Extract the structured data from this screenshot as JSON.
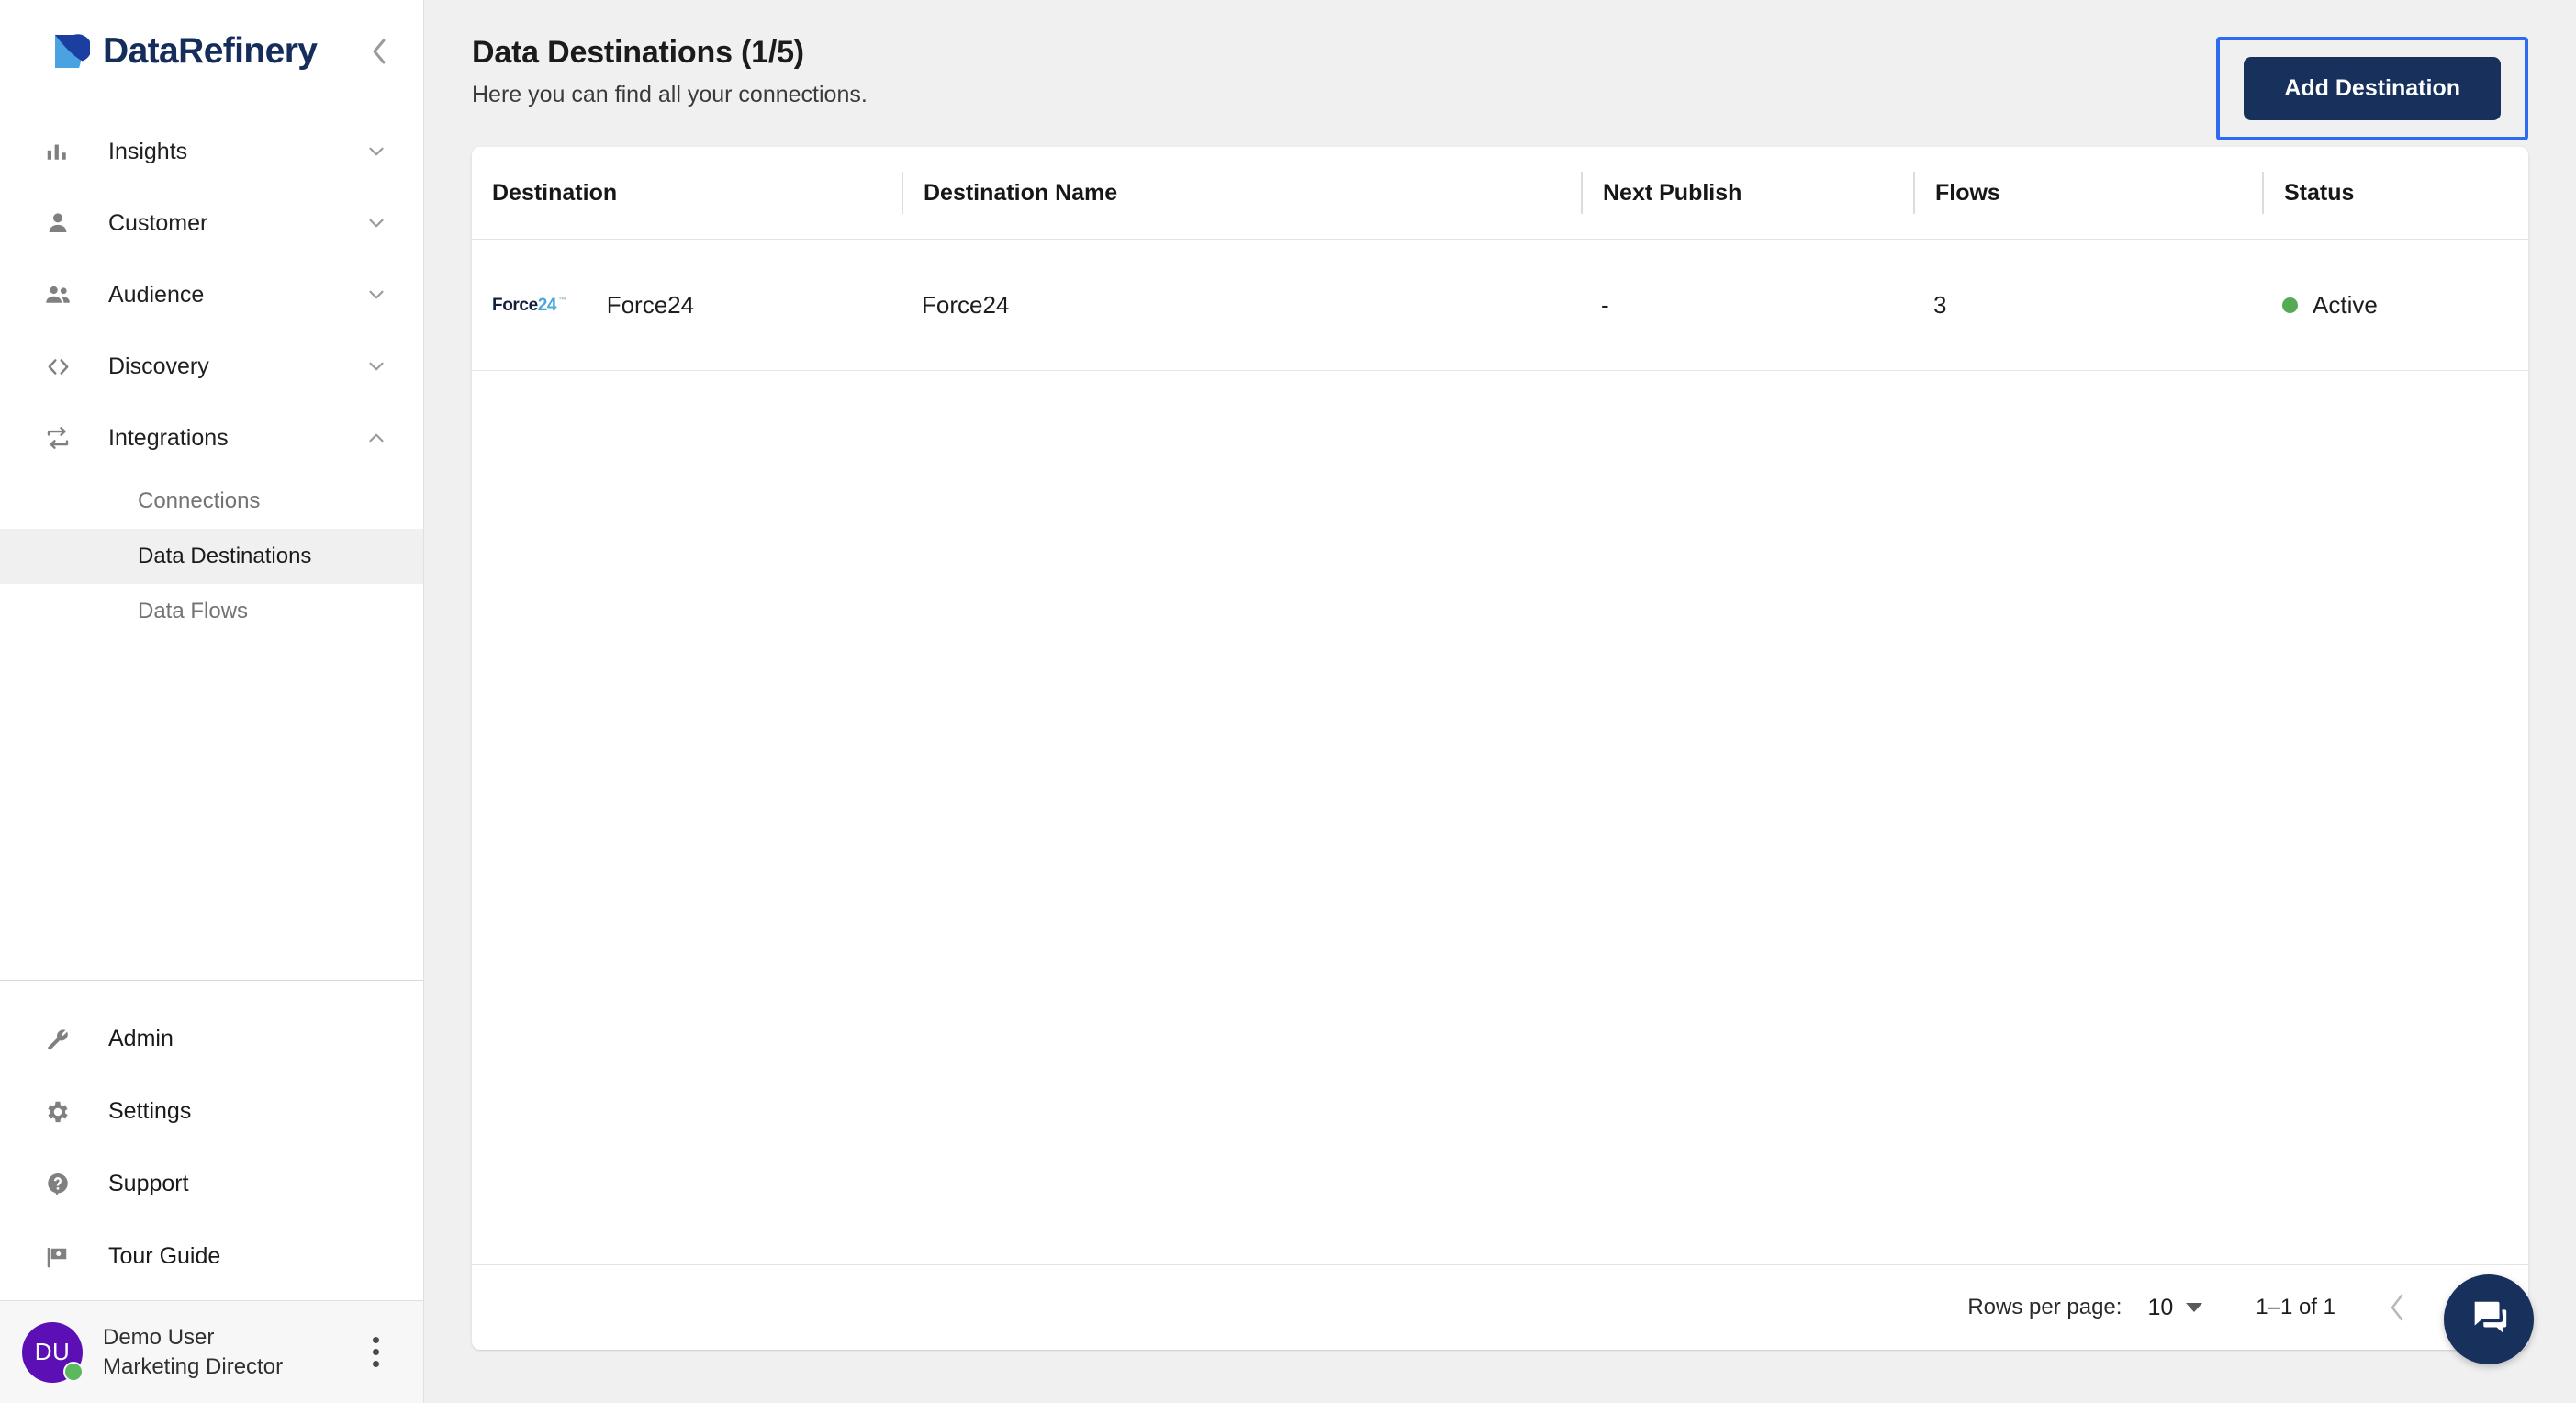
{
  "brand": {
    "name": "DataRefinery",
    "logo_colors": {
      "dark": "#1b3fa0",
      "light": "#4aa3e0"
    },
    "collapse_icon": "chevron-left-icon"
  },
  "sidebar": {
    "nav": [
      {
        "label": "Insights",
        "icon": "bar-chart-icon",
        "chevron": "chevron-down-icon",
        "expanded": false
      },
      {
        "label": "Customer",
        "icon": "person-icon",
        "chevron": "chevron-down-icon",
        "expanded": false
      },
      {
        "label": "Audience",
        "icon": "people-icon",
        "chevron": "chevron-down-icon",
        "expanded": false
      },
      {
        "label": "Discovery",
        "icon": "code-brackets-icon",
        "chevron": "chevron-down-icon",
        "expanded": false
      },
      {
        "label": "Integrations",
        "icon": "sync-arrows-icon",
        "chevron": "chevron-up-icon",
        "expanded": true
      }
    ],
    "subnav": [
      {
        "label": "Connections",
        "active": false
      },
      {
        "label": "Data Destinations",
        "active": true
      },
      {
        "label": "Data Flows",
        "active": false
      }
    ],
    "bottom": [
      {
        "label": "Admin",
        "icon": "wrench-icon"
      },
      {
        "label": "Settings",
        "icon": "gear-icon"
      },
      {
        "label": "Support",
        "icon": "help-circle-icon"
      },
      {
        "label": "Tour Guide",
        "icon": "flag-icon"
      }
    ],
    "user": {
      "initials": "DU",
      "name": "Demo User",
      "role": "Marketing Director",
      "avatar_color": "#5b0fb4",
      "status_color": "#5cb85f",
      "menu_icon": "kebab-menu-icon"
    }
  },
  "header": {
    "title": "Data Destinations (1/5)",
    "subtitle": "Here you can find all your connections.",
    "add_button": "Add Destination",
    "add_button_color": "#17315c",
    "focus_ring_color": "#2f6bf2"
  },
  "table": {
    "columns": [
      "Destination",
      "Destination Name",
      "Next Publish",
      "Flows",
      "Status"
    ],
    "rows": [
      {
        "logo_text_a": "Force",
        "logo_text_b": "24",
        "destination": "Force24",
        "destination_name": "Force24",
        "next_publish": "-",
        "flows": "3",
        "status": "Active",
        "status_color": "#55ab55"
      }
    ]
  },
  "footer": {
    "rows_per_page_label": "Rows per page:",
    "rows_per_page_value": "10",
    "range": "1–1 of 1",
    "prev_icon": "chevron-left-icon"
  },
  "fab": {
    "icon": "chat-forum-icon",
    "color": "#17315c"
  }
}
